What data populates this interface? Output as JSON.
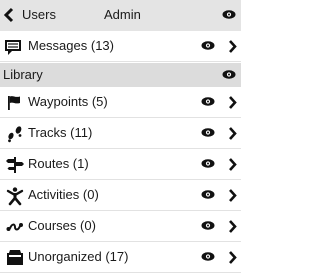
{
  "header": {
    "back_label": "Users",
    "title": "Admin",
    "back_icon": "chevron-left-icon",
    "visibility_icon": "eye-icon"
  },
  "top_items": [
    {
      "label": "Messages (13)",
      "icon": "messages-icon"
    }
  ],
  "library": {
    "section_label": "Library",
    "visibility_icon": "eye-icon",
    "items": [
      {
        "label": "Waypoints (5)",
        "icon": "flag-icon"
      },
      {
        "label": "Tracks (11)",
        "icon": "footprints-icon"
      },
      {
        "label": "Routes (1)",
        "icon": "route-icon"
      },
      {
        "label": "Activities (0)",
        "icon": "person-icon"
      },
      {
        "label": "Courses (0)",
        "icon": "course-icon"
      },
      {
        "label": "Unorganized (17)",
        "icon": "folder-icon"
      }
    ]
  },
  "colors": {
    "header_bg": "#e4e4e4",
    "section_bg": "#dcdcdc",
    "icon": "#111111"
  }
}
